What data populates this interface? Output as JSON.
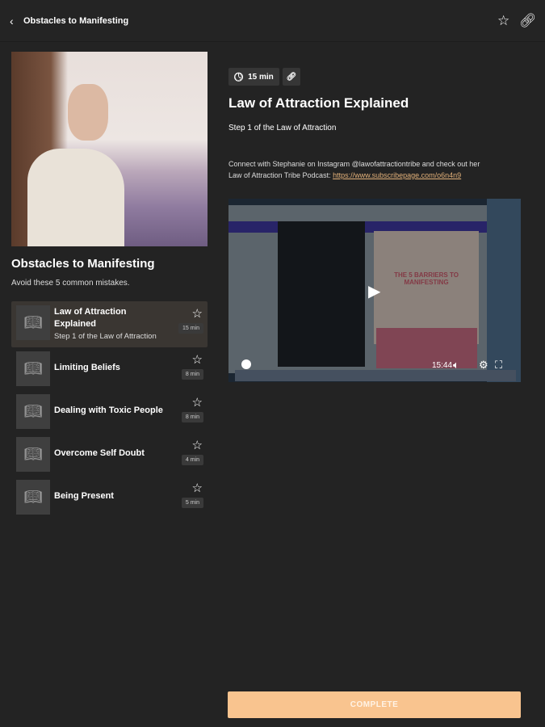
{
  "header": {
    "title": "Obstacles to Manifesting"
  },
  "program": {
    "title": "Obstacles to Manifesting",
    "description": "Avoid these 5 common mistakes."
  },
  "lessons": [
    {
      "title": "Law of Attraction Explained",
      "subtitle": "Step 1 of the Law of Attraction",
      "duration": "15 min"
    },
    {
      "title": "Limiting Beliefs",
      "duration": "8 min"
    },
    {
      "title": "Dealing with Toxic People",
      "duration": "8 min"
    },
    {
      "title": "Overcome Self Doubt",
      "duration": "4 min"
    },
    {
      "title": "Being Present",
      "duration": "5 min"
    }
  ],
  "lesson": {
    "duration": "15 min",
    "title": "Law of Attraction Explained",
    "subtitle": "Step 1 of the Law of Attraction",
    "desc1": "Connect with Stephanie on Instagram @lawofattractiontribe and check out her",
    "desc2": "Law of Attraction Tribe Podcast: ",
    "link": "https://www.subscribepage.com/o6n4n9"
  },
  "video": {
    "slide_title": "THE 5 BARRIERS TO MANIFESTING",
    "time": "15:44"
  },
  "complete_label": "COMPLETE",
  "colors": {
    "accent": "#f9c48f",
    "link": "#e4b27a",
    "background": "#232323"
  }
}
